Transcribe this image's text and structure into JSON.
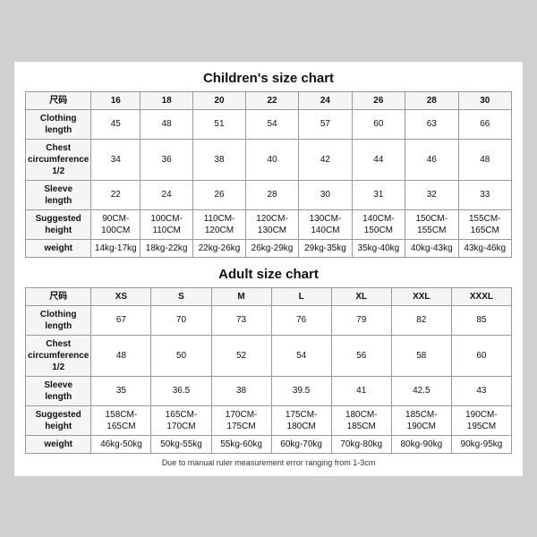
{
  "children_chart": {
    "title": "Children's size chart",
    "columns": [
      "尺码",
      "16",
      "18",
      "20",
      "22",
      "24",
      "26",
      "28",
      "30"
    ],
    "rows": [
      {
        "label": "Clothing\nlength",
        "values": [
          "45",
          "48",
          "51",
          "54",
          "57",
          "60",
          "63",
          "66"
        ]
      },
      {
        "label": "Chest\ncircumference\n1/2",
        "values": [
          "34",
          "36",
          "38",
          "40",
          "42",
          "44",
          "46",
          "48"
        ]
      },
      {
        "label": "Sleeve\nlength",
        "values": [
          "22",
          "24",
          "26",
          "28",
          "30",
          "31",
          "32",
          "33"
        ]
      },
      {
        "label": "Suggested\nheight",
        "values": [
          "90CM-100CM",
          "100CM-110CM",
          "110CM-120CM",
          "120CM-130CM",
          "130CM-140CM",
          "140CM-150CM",
          "150CM-155CM",
          "155CM-165CM"
        ]
      },
      {
        "label": "weight",
        "values": [
          "14kg-17kg",
          "18kg-22kg",
          "22kg-26kg",
          "26kg-29kg",
          "29kg-35kg",
          "35kg-40kg",
          "40kg-43kg",
          "43kg-46kg"
        ]
      }
    ]
  },
  "adult_chart": {
    "title": "Adult size chart",
    "columns": [
      "尺码",
      "XS",
      "S",
      "M",
      "L",
      "XL",
      "XXL",
      "XXXL"
    ],
    "rows": [
      {
        "label": "Clothing\nlength",
        "values": [
          "67",
          "70",
          "73",
          "76",
          "79",
          "82",
          "85"
        ]
      },
      {
        "label": "Chest\ncircumference\n1/2",
        "values": [
          "48",
          "50",
          "52",
          "54",
          "56",
          "58",
          "60"
        ]
      },
      {
        "label": "Sleeve\nlength",
        "values": [
          "35",
          "36.5",
          "38",
          "39.5",
          "41",
          "42.5",
          "43"
        ]
      },
      {
        "label": "Suggested\nheight",
        "values": [
          "158CM-165CM",
          "165CM-170CM",
          "170CM-175CM",
          "175CM-180CM",
          "180CM-185CM",
          "185CM-190CM",
          "190CM-195CM"
        ]
      },
      {
        "label": "weight",
        "values": [
          "46kg-50kg",
          "50kg-55kg",
          "55kg-60kg",
          "60kg-70kg",
          "70kg-80kg",
          "80kg-90kg",
          "90kg-95kg"
        ]
      }
    ]
  },
  "note": "Due to manual ruler measurement error ranging from 1-3cm"
}
